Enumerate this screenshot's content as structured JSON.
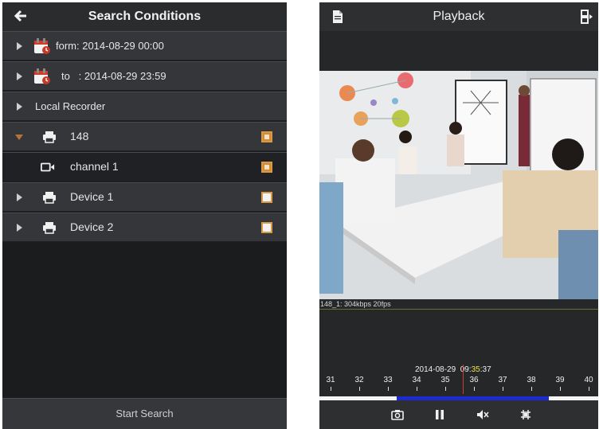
{
  "search": {
    "title": "Search Conditions",
    "from_label": "form: 2014-08-29 00:00",
    "to_label": "to   : 2014-08-29 23:59",
    "recorder_label": "Local Recorder",
    "nodes": [
      {
        "label": "148",
        "checked": true,
        "expanded": true
      },
      {
        "label": "channel 1",
        "checked": true
      },
      {
        "label": "Device 1",
        "checked": false
      },
      {
        "label": "Device 2",
        "checked": false
      }
    ],
    "start_button": "Start Search"
  },
  "playback": {
    "title": "Playback",
    "stream_info": "148_1: 304kbps 20fps",
    "date": "2014-08-29",
    "time_hh": "09:",
    "time_mm": "35",
    "time_ss": ":37",
    "ticks": [
      "31",
      "32",
      "33",
      "34",
      "35",
      "36",
      "37",
      "38",
      "39",
      "40"
    ],
    "cursor_minute": 35.6,
    "recorded_span": [
      33.3,
      38.6
    ]
  },
  "colors": {
    "accent": "#d48a33",
    "record_bar": "#1c2bd0",
    "time_highlight": "#f0e34a",
    "cursor": "#d23a3a"
  }
}
